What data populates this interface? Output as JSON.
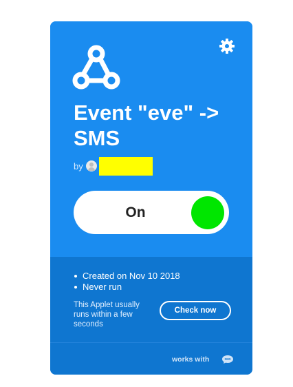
{
  "applet": {
    "title": "Event \"eve\" -> SMS",
    "by_label": "by",
    "author_name": "",
    "toggle_label": "On",
    "settings_icon": "gear-icon",
    "service_icon": "webhooks-icon",
    "colors": {
      "card_top": "#1a8cf0",
      "card_bottom": "#0f76d0",
      "toggle_on": "#00e600",
      "author_highlight": "#ffff00"
    }
  },
  "details": {
    "items": [
      "Created on Nov 10 2018",
      "Never run"
    ],
    "runs_note": "This Applet usually runs within a few seconds",
    "check_now_label": "Check now"
  },
  "footer": {
    "works_with_label": "works with",
    "works_with_icon": "sms-icon",
    "works_with_icon_text": "SMS"
  }
}
